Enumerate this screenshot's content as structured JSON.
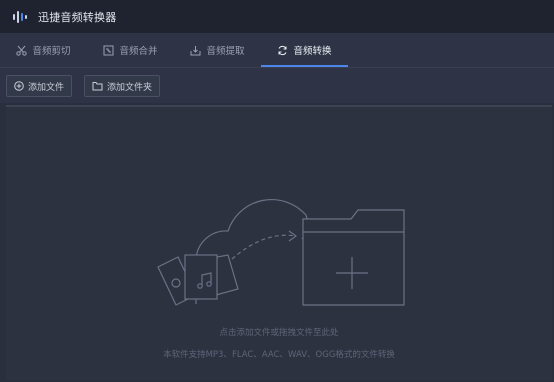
{
  "app": {
    "title": "迅捷音频转换器"
  },
  "tabs": [
    {
      "label": "音频剪切",
      "icon": "scissors-icon"
    },
    {
      "label": "音频合并",
      "icon": "merge-icon"
    },
    {
      "label": "音频提取",
      "icon": "extract-icon"
    },
    {
      "label": "音频转换",
      "icon": "convert-icon",
      "active": true
    }
  ],
  "toolbar": {
    "add_file_label": "添加文件",
    "add_folder_label": "添加文件夹"
  },
  "dropzone": {
    "hint": "点击添加文件或拖拽文件至此处",
    "formats": "本软件支持MP3、FLAC、AAC、WAV、OGG格式的文件转换"
  },
  "colors": {
    "accent": "#4c86e8",
    "titlebar": "#1f2330",
    "background": "#2a2f3d"
  }
}
